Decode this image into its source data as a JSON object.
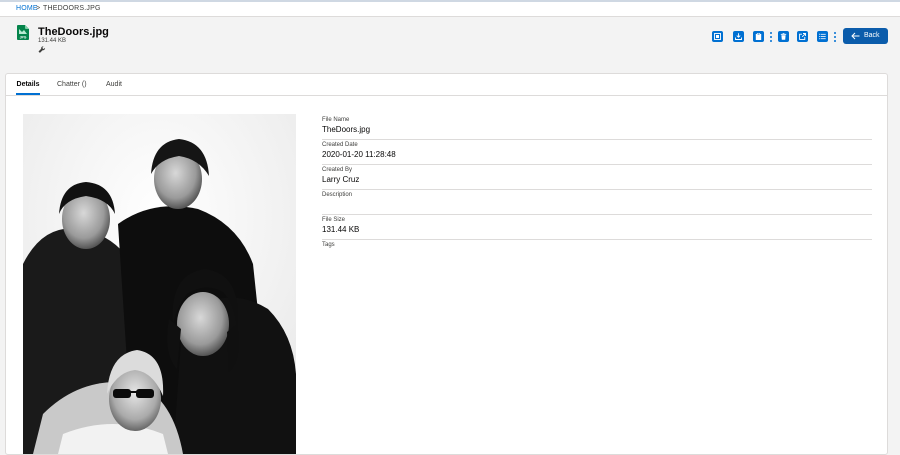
{
  "breadcrumb": {
    "home": "HOME",
    "separator": ">",
    "current": "THEDOORS.JPG"
  },
  "header": {
    "file_icon_label": "JPG",
    "title": "TheDoors.jpg",
    "size": "131.44 KB",
    "toolbar_icons": [
      "preview-icon",
      "download-icon",
      "clipboard-icon",
      "delete-icon",
      "share-icon",
      "list-icon"
    ],
    "back_label": "Back"
  },
  "tabs": [
    {
      "label": "Details",
      "active": true
    },
    {
      "label": "Chatter ()",
      "active": false
    },
    {
      "label": "Audit",
      "active": false
    }
  ],
  "details": {
    "fields": [
      {
        "label": "File Name",
        "value": "TheDoors.jpg"
      },
      {
        "label": "Created Date",
        "value": "2020-01-20 11:28:48"
      },
      {
        "label": "Created By",
        "value": "Larry Cruz"
      },
      {
        "label": "Description",
        "value": ""
      },
      {
        "label": "File Size",
        "value": "131.44 KB"
      },
      {
        "label": "Tags",
        "value": ""
      }
    ]
  },
  "colors": {
    "brand": "#0070d2",
    "back_button": "#0b5cab",
    "file_icon": "#04844b"
  }
}
